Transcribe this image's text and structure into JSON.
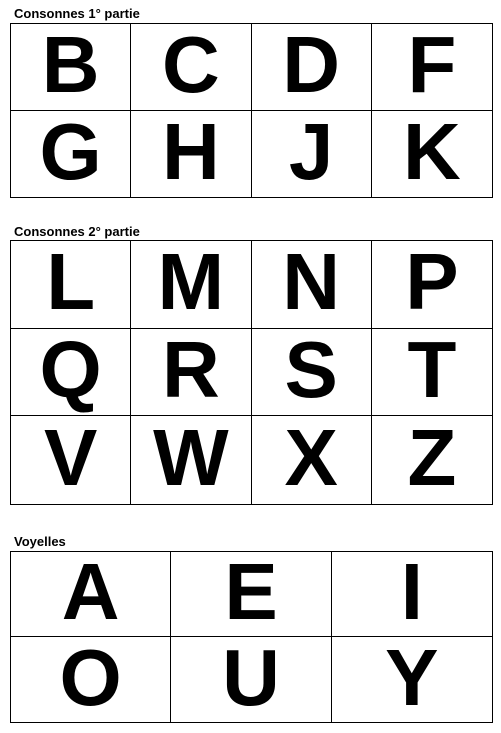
{
  "sections": [
    {
      "title": "Consonnes 1° partie",
      "letters": [
        "B",
        "C",
        "D",
        "F",
        "G",
        "H",
        "J",
        "K"
      ]
    },
    {
      "title": "Consonnes 2° partie",
      "letters": [
        "L",
        "M",
        "N",
        "P",
        "Q",
        "R",
        "S",
        "T",
        "V",
        "W",
        "X",
        "Z"
      ]
    },
    {
      "title": "Voyelles",
      "letters": [
        "A",
        "E",
        "I",
        "O",
        "U",
        "Y"
      ]
    }
  ]
}
